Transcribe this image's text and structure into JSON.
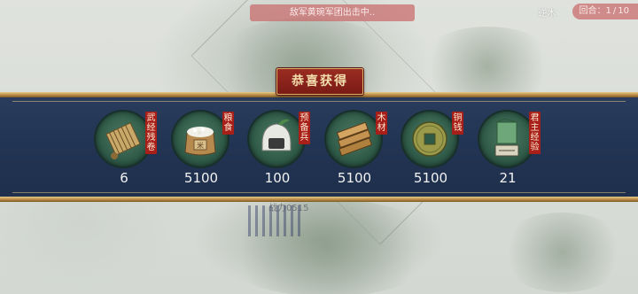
{
  "hud": {
    "notice": "敌军黄琬军团出击中..",
    "player_name": "逆木",
    "turn_label": "回合",
    "turn_current": "1",
    "turn_total": "10"
  },
  "map": {
    "troop_label": "战力0515"
  },
  "reward_panel": {
    "title": "恭喜获得",
    "items": [
      {
        "tag": "武经残卷",
        "amount": "6",
        "icon": "scroll-bundle-icon"
      },
      {
        "tag": "粮食",
        "amount": "5100",
        "icon": "grain-sack-icon"
      },
      {
        "tag": "预备兵",
        "amount": "100",
        "icon": "helmet-icon"
      },
      {
        "tag": "木材",
        "amount": "5100",
        "icon": "wood-planks-icon"
      },
      {
        "tag": "铜钱",
        "amount": "5100",
        "icon": "copper-coin-icon"
      },
      {
        "tag": "君主经验",
        "amount": "21",
        "icon": "fame-banner-icon"
      }
    ],
    "colors": {
      "panel": "#223453",
      "gold": "#d9b46a",
      "tag_red": "#a81e18"
    }
  }
}
